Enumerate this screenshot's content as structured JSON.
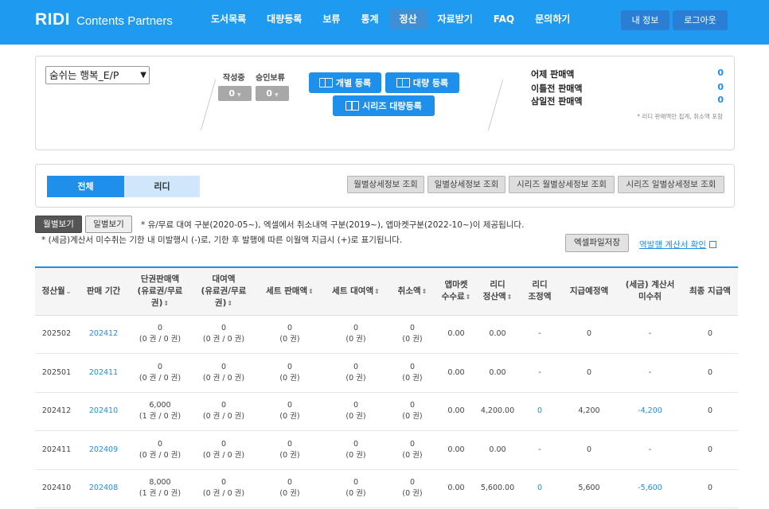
{
  "header": {
    "logo_main": "RIDI",
    "logo_sub": "Contents Partners",
    "nav": [
      "도서목록",
      "대량등록",
      "보류",
      "통계",
      "정산",
      "자료받기",
      "FAQ",
      "문의하기"
    ],
    "active_nav": "정산",
    "my_info": "내 정보",
    "logout": "로그아웃"
  },
  "summary": {
    "book_select": "숨쉬는 행복_E/P",
    "writing_label": "작성중",
    "writing_value": "0",
    "approval_hold_label": "승인보류",
    "approval_hold_value": "0",
    "individual_register": "개별 등록",
    "bulk_register": "대량 등록",
    "series_bulk_register": "시리즈 대량등록",
    "sales": [
      {
        "label": "어제 판매액",
        "value": "0"
      },
      {
        "label": "이틀전 판매액",
        "value": "0"
      },
      {
        "label": "삼일전 판매액",
        "value": "0"
      }
    ],
    "sales_note": "* 리디 판매액만 집계, 취소액 포함"
  },
  "filter": {
    "tab_all": "전체",
    "tab_ridi": "리디",
    "query_buttons": [
      "월별상세정보 조회",
      "일별상세정보 조회",
      "시리즈 월별상세정보 조회",
      "시리즈 일별상세정보 조회"
    ]
  },
  "view": {
    "monthly": "월별보기",
    "daily": "일별보기",
    "notice1": "* 유/무료 대여 구분(2020-05~), 엑셀에서 취소내역 구분(2019~), 앱마켓구분(2022-10~)이 제공됩니다.",
    "notice2": "* (세금)계산서 미수취는 기한 내 미발행시 (-)로, 기한 후 발행에 따른 이월액 지급시 (+)로 표기됩니다.",
    "excel_save": "엑셀파일저장",
    "reverse_invoice": "역발행 계산서 확인"
  },
  "table": {
    "headers": [
      "정산월",
      "판매 기간",
      "단권판매액\n(유료권/무료\n권)",
      "대여액\n(유료권/무료\n권)",
      "세트 판매액",
      "세트 대여액",
      "취소액",
      "앱마켓\n수수료",
      "리디\n정산액",
      "리디\n조정액",
      "지급예정액",
      "(세금) 계산서\n미수취",
      "최종 지급액"
    ],
    "rows": [
      [
        "202502",
        "202412",
        "0\n(0 권 / 0 권)",
        "0\n(0 권 / 0 권)",
        "0\n(0 권)",
        "0\n(0 권)",
        "0\n(0 권)",
        "0.00",
        "0.00",
        "-",
        "0",
        "-",
        "0"
      ],
      [
        "202501",
        "202411",
        "0\n(0 권 / 0 권)",
        "0\n(0 권 / 0 권)",
        "0\n(0 권)",
        "0\n(0 권)",
        "0\n(0 권)",
        "0.00",
        "0.00",
        "-",
        "0",
        "-",
        "0"
      ],
      [
        "202412",
        "202410",
        "6,000\n(1 권 / 0 권)",
        "0\n(0 권 / 0 권)",
        "0\n(0 권)",
        "0\n(0 권)",
        "0\n(0 권)",
        "0.00",
        "4,200.00",
        "0",
        "4,200",
        "-4,200",
        "0"
      ],
      [
        "202411",
        "202409",
        "0\n(0 권 / 0 권)",
        "0\n(0 권 / 0 권)",
        "0\n(0 권)",
        "0\n(0 권)",
        "0\n(0 권)",
        "0.00",
        "0.00",
        "-",
        "0",
        "-",
        "0"
      ],
      [
        "202410",
        "202408",
        "8,000\n(1 권 / 0 권)",
        "0\n(0 권 / 0 권)",
        "0\n(0 권)",
        "0\n(0 권)",
        "0\n(0 권)",
        "0.00",
        "5,600.00",
        "0",
        "5,600",
        "-5,600",
        "0"
      ]
    ]
  },
  "colors": {
    "brand": "#1e9bf0",
    "accent": "#1e8fea",
    "tab_inactive": "#cfe6fb"
  }
}
